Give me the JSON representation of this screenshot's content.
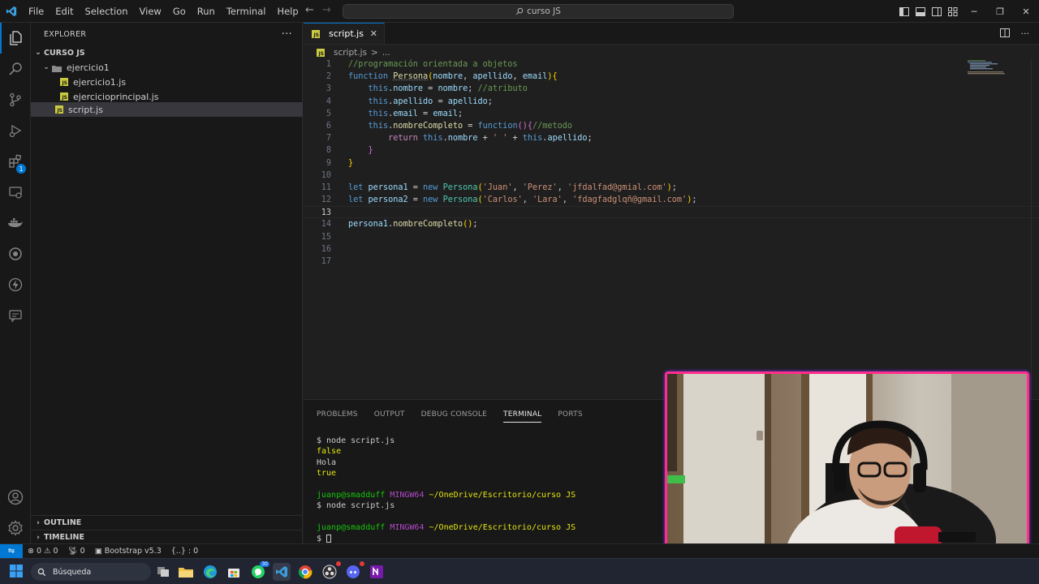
{
  "titlebar": {
    "menu": [
      "File",
      "Edit",
      "Selection",
      "View",
      "Go",
      "Run",
      "Terminal",
      "Help"
    ],
    "search_text": "curso JS"
  },
  "activitybar": {
    "extensions_badge": "1"
  },
  "sidebar": {
    "title": "EXPLORER",
    "more": "···",
    "root": "CURSO JS",
    "folder": "ejercicio1",
    "files_in_folder": [
      "ejercicio1.js",
      "ejercicioprincipal.js"
    ],
    "root_file": "script.js",
    "outline": "OUTLINE",
    "timeline": "TIMELINE"
  },
  "editor": {
    "tab_label": "script.js",
    "breadcrumb_file": "script.js",
    "breadcrumb_sep": ">",
    "breadcrumb_more": "...",
    "line_numbers": [
      "1",
      "2",
      "3",
      "4",
      "5",
      "6",
      "7",
      "8",
      "9",
      "10",
      "11",
      "12",
      "13",
      "14",
      "15",
      "16",
      "17"
    ],
    "current_line": 13
  },
  "panel": {
    "tabs": [
      "PROBLEMS",
      "OUTPUT",
      "DEBUG CONSOLE",
      "TERMINAL",
      "PORTS"
    ],
    "active_tab": "TERMINAL",
    "terminal": {
      "cmd1": "$ node script.js",
      "out1": "false",
      "out2": "Hola",
      "out3": "true",
      "user": "juanp@smadduff",
      "shell": "MINGW64",
      "path": "~/OneDrive/Escritorio/curso JS",
      "cmd2": "$ node script.js",
      "prompt": "$"
    }
  },
  "statusbar": {
    "errors": "0",
    "warnings": "0",
    "ports": "0",
    "extension": "Bootstrap v5.3",
    "selection": "{..} : 0"
  },
  "taskbar": {
    "search_label": "Búsqueda",
    "whatsapp_badge": "30"
  },
  "colors": {
    "accent": "#0078d4",
    "webcam_border": "#ff2e8a"
  }
}
